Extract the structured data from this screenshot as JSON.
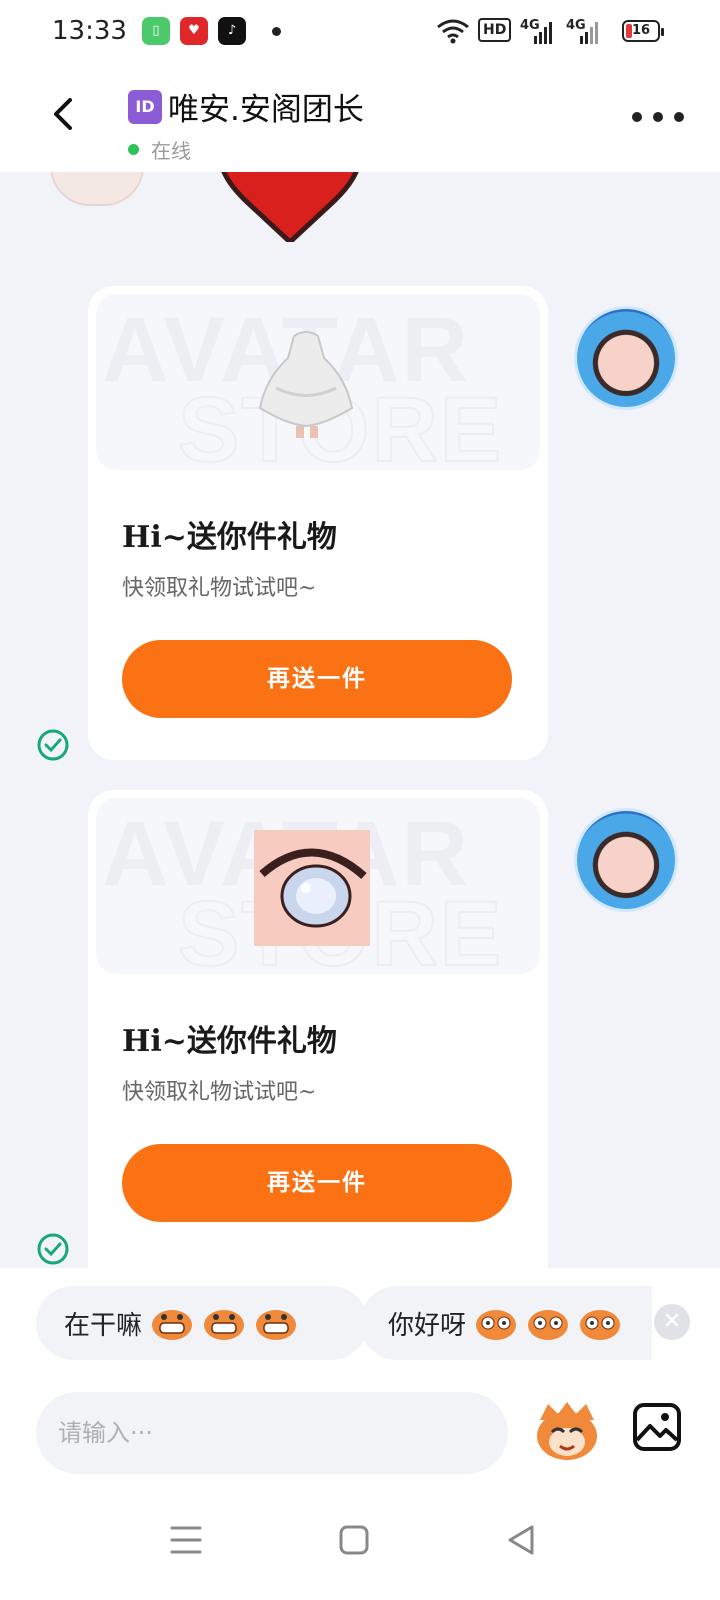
{
  "status_bar": {
    "time": "13:33",
    "battery_level": "16",
    "network_labels": [
      "HD",
      "4G",
      "4G"
    ]
  },
  "header": {
    "id_badge": "ID",
    "title": "唯安.安阁团长",
    "status": "在线"
  },
  "messages": [
    {
      "card_title": "Hi~送你件礼物",
      "card_subtitle": "快领取礼物试试吧~",
      "button_label": "再送一件",
      "gift": "white-dress-icon"
    },
    {
      "card_title": "Hi~送你件礼物",
      "card_subtitle": "快领取礼物试试吧~",
      "button_label": "再送一件",
      "gift": "anime-eye-icon"
    }
  ],
  "quick_replies": [
    {
      "text": "在干嘛"
    },
    {
      "text": "你好呀"
    }
  ],
  "input": {
    "placeholder": "请输入···",
    "value": ""
  },
  "colors": {
    "accent_orange": "#fa7213",
    "online_green": "#2ec25a",
    "check_green": "#17a877"
  }
}
